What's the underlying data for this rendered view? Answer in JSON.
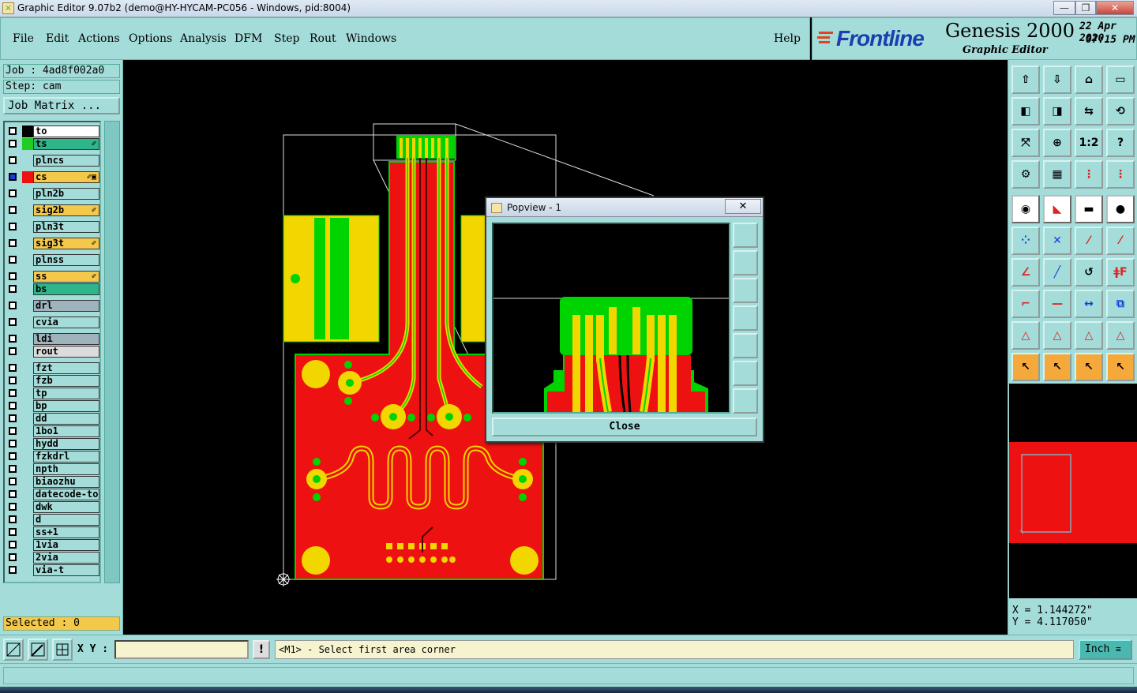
{
  "window": {
    "title": "Graphic Editor 9.07b2 (demo@HY-HYCAM-PC056 - Windows, pid:8004)",
    "minimize": "—",
    "maximize": "❐",
    "close": "✕"
  },
  "menu": {
    "items": [
      "File",
      "Edit",
      "Actions",
      "Options",
      "Analysis",
      "DFM",
      "Step",
      "Rout",
      "Windows"
    ],
    "help": "Help"
  },
  "brand": {
    "logo": "Frontline",
    "app": "Genesis 2000",
    "subtitle": "Graphic Editor",
    "date": "22 Apr 2020",
    "time": "07:15 PM"
  },
  "job": {
    "job_label": "Job : 4ad8f002a0",
    "step_label": "Step: cam",
    "matrix_button": "Job Matrix ..."
  },
  "layers": [
    {
      "name": "to",
      "color": "#ffffff",
      "swatch": "#000000",
      "check": "white",
      "mark": ""
    },
    {
      "name": "ts",
      "color": "#2eb58a",
      "swatch": "#22cc22",
      "check": "white",
      "mark": "✐"
    },
    {
      "name": "plncs",
      "color": "#a4dcd9",
      "swatch": "",
      "check": "white",
      "mark": ""
    },
    {
      "name": "cs",
      "color": "#f4c84a",
      "swatch": "#ee1111",
      "check": "blue",
      "mark": "✐▣"
    },
    {
      "name": "pln2b",
      "color": "#a4dcd9",
      "swatch": "",
      "check": "white",
      "mark": ""
    },
    {
      "name": "sig2b",
      "color": "#f4c84a",
      "swatch": "",
      "check": "white",
      "mark": "✐"
    },
    {
      "name": "pln3t",
      "color": "#a4dcd9",
      "swatch": "",
      "check": "white",
      "mark": ""
    },
    {
      "name": "sig3t",
      "color": "#f4c84a",
      "swatch": "",
      "check": "white",
      "mark": "✐"
    },
    {
      "name": "plnss",
      "color": "#a4dcd9",
      "swatch": "",
      "check": "white",
      "mark": ""
    },
    {
      "name": "ss",
      "color": "#f4c84a",
      "swatch": "",
      "check": "white",
      "mark": "✐"
    },
    {
      "name": "bs",
      "color": "#2eb58a",
      "swatch": "",
      "check": "white",
      "mark": ""
    },
    {
      "name": "drl",
      "color": "#9fb3bd",
      "swatch": "",
      "check": "white",
      "mark": ""
    },
    {
      "name": "cvia",
      "color": "#a4dcd9",
      "swatch": "",
      "check": "white",
      "mark": ""
    },
    {
      "name": "ldi",
      "color": "#9fb3bd",
      "swatch": "",
      "check": "white",
      "mark": ""
    },
    {
      "name": "rout",
      "color": "#dcdcdc",
      "swatch": "",
      "check": "white",
      "mark": ""
    },
    {
      "name": "fzt",
      "color": "#a4dcd9",
      "swatch": "",
      "check": "white",
      "mark": ""
    },
    {
      "name": "fzb",
      "color": "#a4dcd9",
      "swatch": "",
      "check": "white",
      "mark": ""
    },
    {
      "name": "tp",
      "color": "#a4dcd9",
      "swatch": "",
      "check": "white",
      "mark": ""
    },
    {
      "name": "bp",
      "color": "#a4dcd9",
      "swatch": "",
      "check": "white",
      "mark": ""
    },
    {
      "name": "dd",
      "color": "#a4dcd9",
      "swatch": "",
      "check": "white",
      "mark": ""
    },
    {
      "name": "1bo1",
      "color": "#a4dcd9",
      "swatch": "",
      "check": "white",
      "mark": ""
    },
    {
      "name": "hydd",
      "color": "#a4dcd9",
      "swatch": "",
      "check": "white",
      "mark": ""
    },
    {
      "name": "fzkdrl",
      "color": "#a4dcd9",
      "swatch": "",
      "check": "white",
      "mark": ""
    },
    {
      "name": "npth",
      "color": "#a4dcd9",
      "swatch": "",
      "check": "white",
      "mark": ""
    },
    {
      "name": "biaozhu",
      "color": "#a4dcd9",
      "swatch": "",
      "check": "white",
      "mark": ""
    },
    {
      "name": "datecode-to",
      "color": "#a4dcd9",
      "swatch": "",
      "check": "white",
      "mark": ""
    },
    {
      "name": "dwk",
      "color": "#a4dcd9",
      "swatch": "",
      "check": "white",
      "mark": ""
    },
    {
      "name": "d",
      "color": "#a4dcd9",
      "swatch": "",
      "check": "white",
      "mark": ""
    },
    {
      "name": "ss+1",
      "color": "#a4dcd9",
      "swatch": "",
      "check": "white",
      "mark": ""
    },
    {
      "name": "1via",
      "color": "#a4dcd9",
      "swatch": "",
      "check": "white",
      "mark": ""
    },
    {
      "name": "2via",
      "color": "#a4dcd9",
      "swatch": "",
      "check": "white",
      "mark": ""
    },
    {
      "name": "via-t",
      "color": "#a4dcd9",
      "swatch": "",
      "check": "white",
      "mark": ""
    }
  ],
  "selected": "Selected : 0",
  "popview": {
    "title": "Popview - 1",
    "close_x": "✕",
    "close_button": "Close"
  },
  "coords": {
    "x": "X = 1.144272\"",
    "y": "Y = 4.117050\""
  },
  "cmdline": {
    "xy_label": "X Y :",
    "xy_value": "",
    "warn": "!",
    "prompt": "<M1> - Select first area corner",
    "unit": "Inch"
  },
  "colors": {
    "panel": "#a4dcd9",
    "copper_top": "#f1d600",
    "mask": "#00d400",
    "cs_layer": "#ee1111"
  },
  "toolbar_icons": [
    "step-up-icon",
    "step-down-icon",
    "home-icon",
    "window-icon",
    "pan-left-icon",
    "pan-right-icon",
    "flip-icon",
    "reverse-icon",
    "zoom-fit-icon",
    "zoom-center-icon",
    "scale-1-2-icon",
    "help-icon",
    "settings-icon",
    "grid-icon",
    "layers-red-icon",
    "layers-red-2-icon",
    "snap-center-icon",
    "draw-line-icon",
    "ruler-icon",
    "dot-icon",
    "connect-nodes-icon",
    "cross-icon",
    "segment-icon",
    "segment-2-icon",
    "angle-icon",
    "slash-icon",
    "arc-icon",
    "mirror-f-icon",
    "corner-icon",
    "minus-icon",
    "measure-icon",
    "shapes-icon",
    "triangle-1-icon",
    "triangle-2-icon",
    "triangle-3-icon",
    "triangle-4-icon",
    "pointer-icon",
    "pointer-box-icon",
    "pointer-circle-icon",
    "pointer-path-icon"
  ]
}
